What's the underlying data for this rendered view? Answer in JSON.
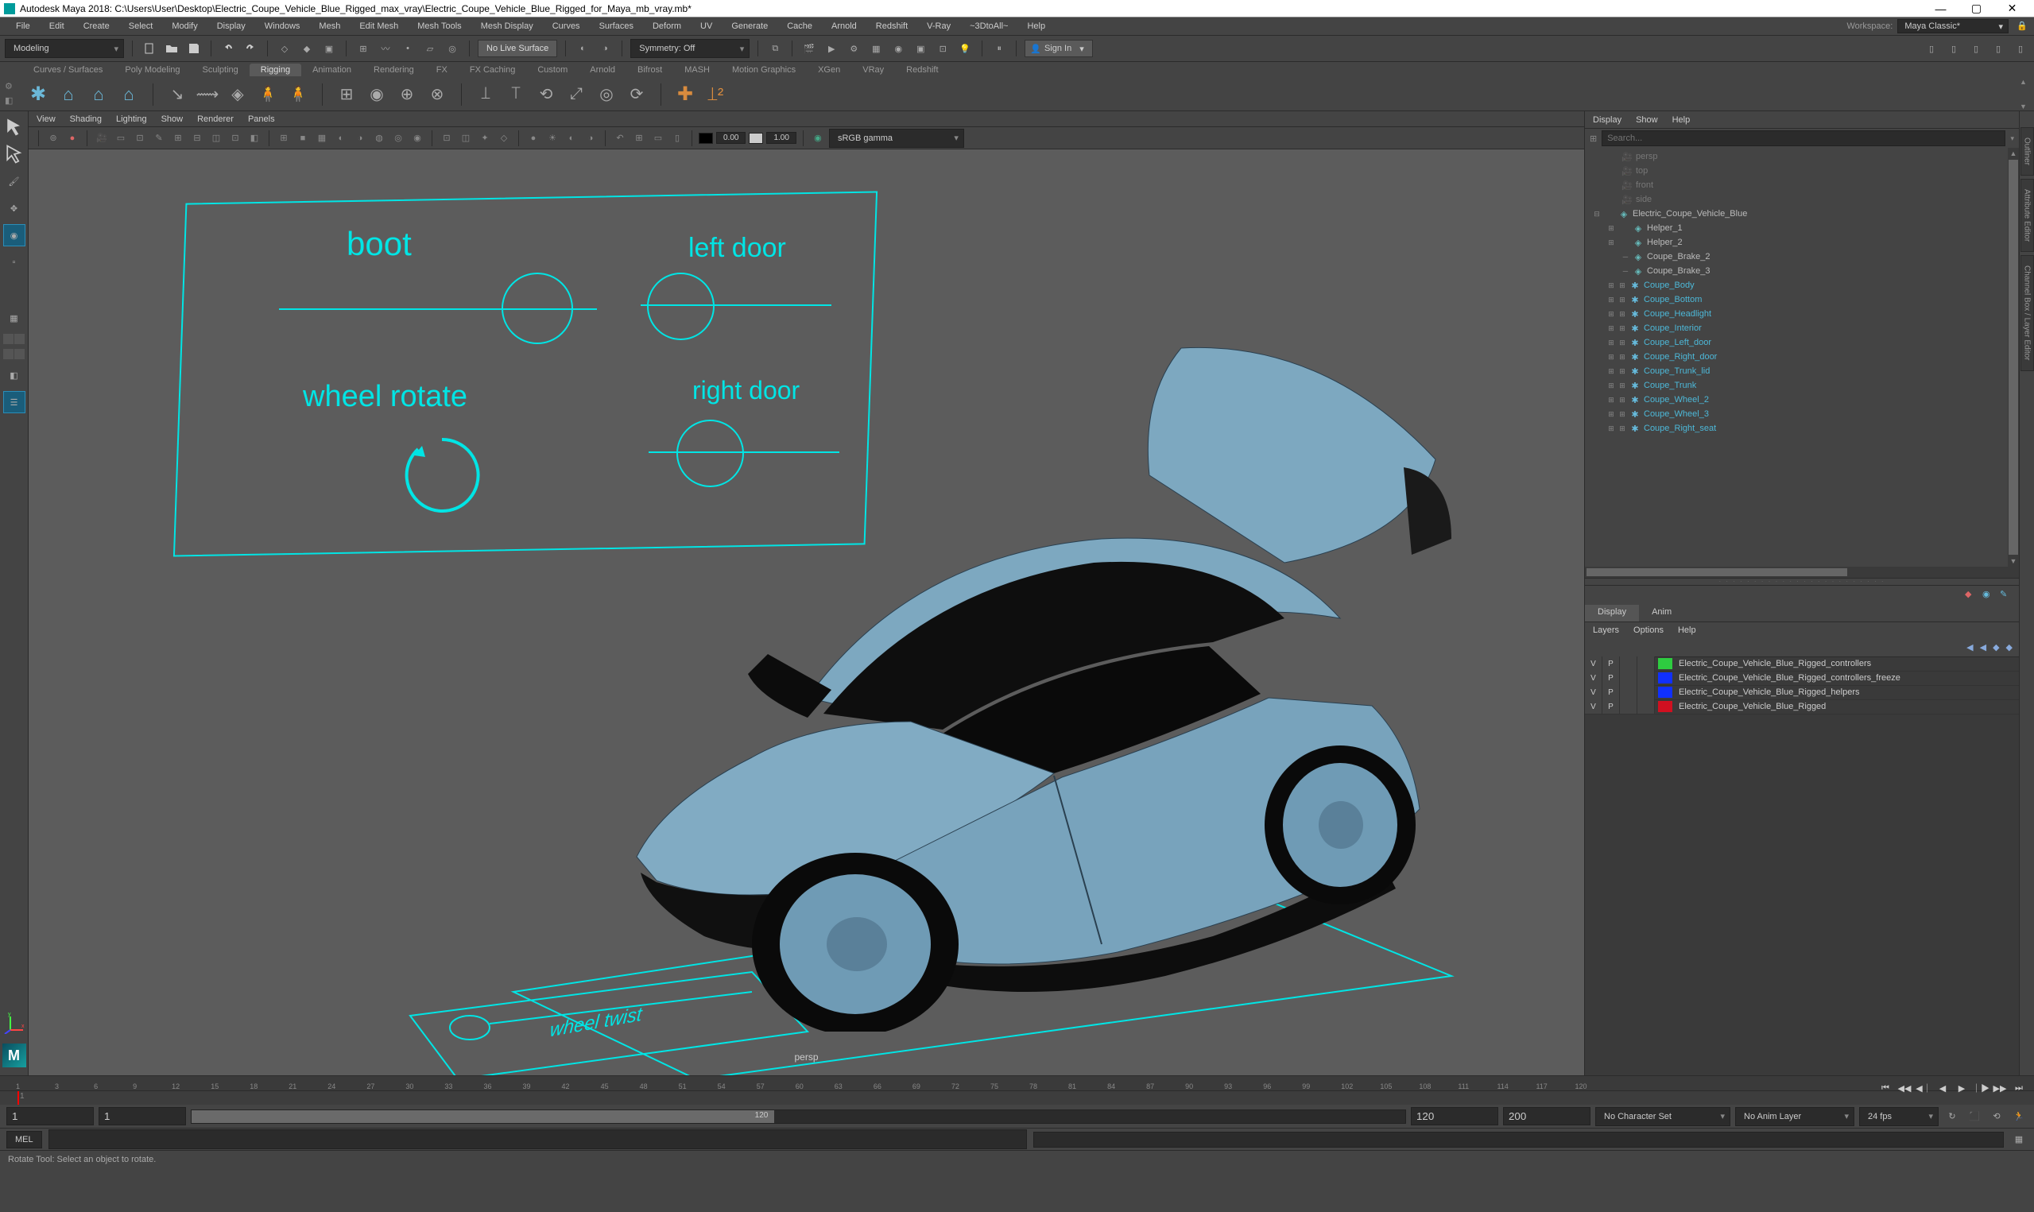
{
  "titlebar": {
    "title": "Autodesk Maya 2018: C:\\Users\\User\\Desktop\\Electric_Coupe_Vehicle_Blue_Rigged_max_vray\\Electric_Coupe_Vehicle_Blue_Rigged_for_Maya_mb_vray.mb*"
  },
  "menubar": {
    "items": [
      "File",
      "Edit",
      "Create",
      "Select",
      "Modify",
      "Display",
      "Windows",
      "Mesh",
      "Edit Mesh",
      "Mesh Tools",
      "Mesh Display",
      "Curves",
      "Surfaces",
      "Deform",
      "UV",
      "Generate",
      "Cache",
      "Arnold",
      "Redshift",
      "V-Ray",
      "~3DtoAll~",
      "Help"
    ],
    "workspace_label": "Workspace:",
    "workspace_value": "Maya Classic*"
  },
  "statusline": {
    "mode": "Modeling",
    "nolive": "No Live Surface",
    "symmetry": "Symmetry: Off",
    "signin": "Sign In"
  },
  "shelf": {
    "tabs": [
      "Curves / Surfaces",
      "Poly Modeling",
      "Sculpting",
      "Rigging",
      "Animation",
      "Rendering",
      "FX",
      "FX Caching",
      "Custom",
      "Arnold",
      "Bifrost",
      "MASH",
      "Motion Graphics",
      "XGen",
      "VRay",
      "Redshift"
    ],
    "active": "Rigging"
  },
  "viewport": {
    "menus": [
      "View",
      "Shading",
      "Lighting",
      "Show",
      "Renderer",
      "Panels"
    ],
    "field1": "0.00",
    "field2": "1.00",
    "colorspace": "sRGB gamma",
    "persp": "persp",
    "rig": {
      "boot": "boot",
      "leftdoor": "left door",
      "wheelrotate": "wheel rotate",
      "rightdoor": "right door",
      "wheeltwist": "wheel twist"
    }
  },
  "outliner": {
    "menus": [
      "Display",
      "Show",
      "Help"
    ],
    "search_ph": "Search...",
    "cams": [
      "persp",
      "top",
      "front",
      "side"
    ],
    "root": "Electric_Coupe_Vehicle_Blue",
    "helpers": [
      "Helper_1",
      "Helper_2"
    ],
    "brakes": [
      "Coupe_Brake_2",
      "Coupe_Brake_3"
    ],
    "parts": [
      "Coupe_Body",
      "Coupe_Bottom",
      "Coupe_Headlight",
      "Coupe_Interior",
      "Coupe_Left_door",
      "Coupe_Right_door",
      "Coupe_Trunk_lid",
      "Coupe_Trunk",
      "Coupe_Wheel_2",
      "Coupe_Wheel_3",
      "Coupe_Right_seat"
    ]
  },
  "layers": {
    "tab_display": "Display",
    "tab_anim": "Anim",
    "menus": [
      "Layers",
      "Options",
      "Help"
    ],
    "rows": [
      {
        "v": "V",
        "p": "P",
        "color": "#2ecc40",
        "name": "Electric_Coupe_Vehicle_Blue_Rigged_controllers"
      },
      {
        "v": "V",
        "p": "P",
        "color": "#1030ff",
        "name": "Electric_Coupe_Vehicle_Blue_Rigged_controllers_freeze"
      },
      {
        "v": "V",
        "p": "P",
        "color": "#1030ff",
        "name": "Electric_Coupe_Vehicle_Blue_Rigged_helpers"
      },
      {
        "v": "V",
        "p": "P",
        "color": "#d01020",
        "name": "Electric_Coupe_Vehicle_Blue_Rigged"
      }
    ]
  },
  "timeline": {
    "current": "1",
    "ticks": [
      "1",
      "3",
      "6",
      "9",
      "12",
      "15",
      "18",
      "21",
      "24",
      "27",
      "30",
      "33",
      "36",
      "39",
      "42",
      "45",
      "48",
      "51",
      "54",
      "57",
      "60",
      "63",
      "66",
      "69",
      "72",
      "75",
      "78",
      "81",
      "84",
      "87",
      "90",
      "93",
      "96",
      "99",
      "102",
      "105",
      "108",
      "111",
      "114",
      "117",
      "120"
    ]
  },
  "range": {
    "start": "1",
    "startmin": "1",
    "end": "120",
    "endmax": "200",
    "nochar": "No Character Set",
    "noanim": "No Anim Layer",
    "fps": "24 fps"
  },
  "mel": {
    "label": "MEL"
  },
  "helpline": "Rotate Tool: Select an object to rotate.",
  "vtabs": [
    "Outliner",
    "Attribute Editor",
    "Channel Box / Layer Editor"
  ]
}
